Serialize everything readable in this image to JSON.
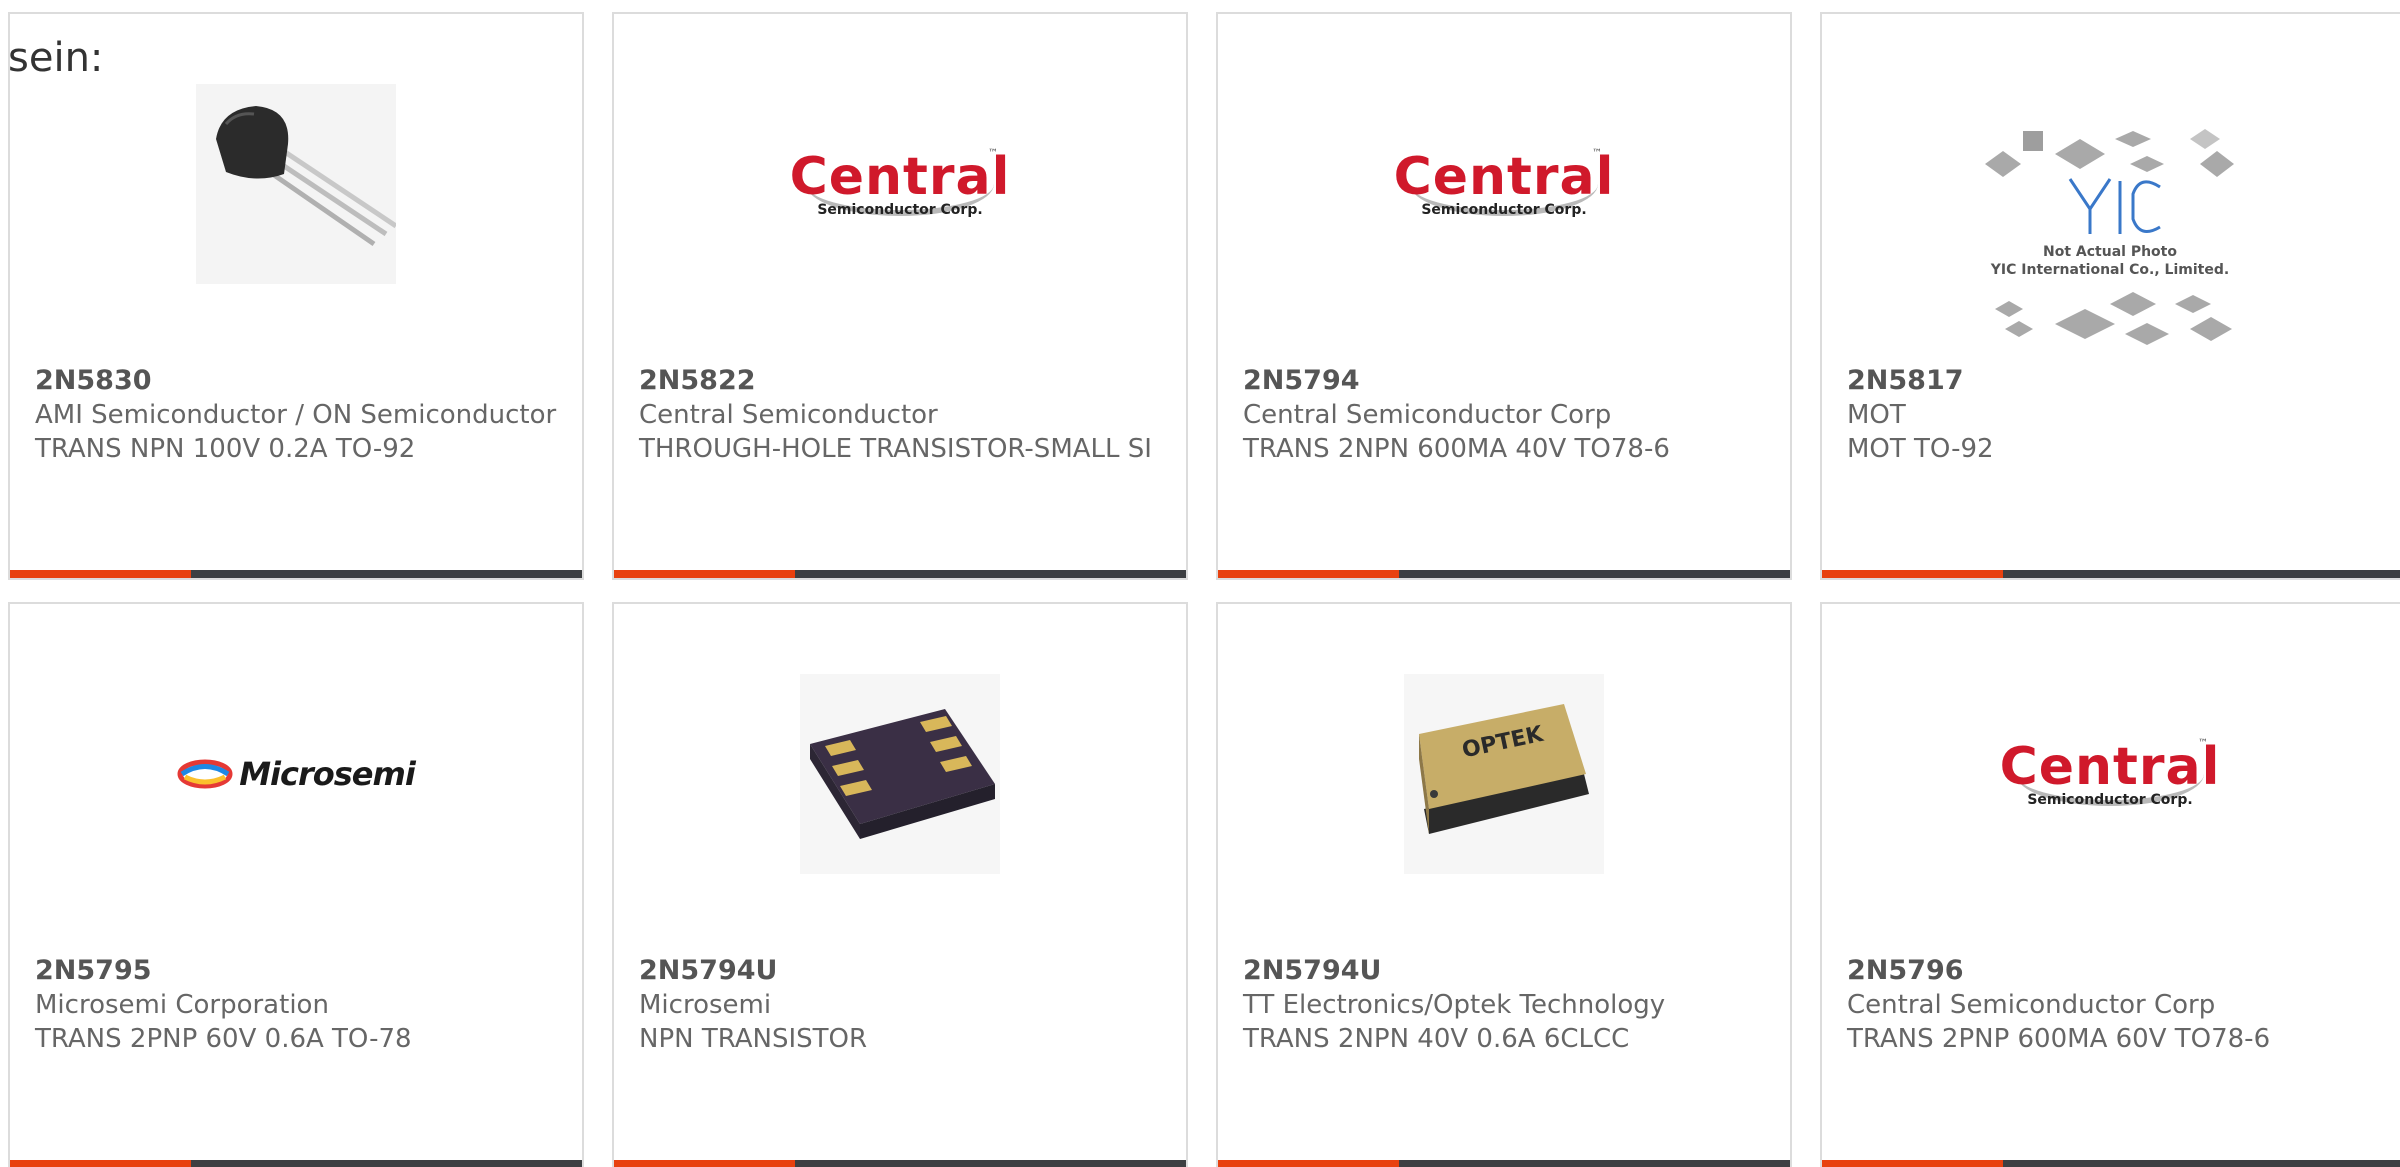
{
  "lead_text": "sein:",
  "cards": [
    {
      "part_number": "2N5830",
      "manufacturer": "AMI Semiconductor / ON Semiconductor",
      "description": "TRANS NPN 100V 0.2A TO-92",
      "image": "transistor-to92-photo"
    },
    {
      "part_number": "2N5822",
      "manufacturer": "Central Semiconductor",
      "description": "THROUGH-HOLE TRANSISTOR-SMALL SI",
      "image": "central-logo"
    },
    {
      "part_number": "2N5794",
      "manufacturer": "Central Semiconductor Corp",
      "description": "TRANS 2NPN 600MA 40V TO78-6",
      "image": "central-logo"
    },
    {
      "part_number": "2N5817",
      "manufacturer": "MOT",
      "description": "MOT TO-92",
      "image": "yic-placeholder"
    },
    {
      "part_number": "2N5795",
      "manufacturer": "Microsemi Corporation",
      "description": "TRANS 2PNP 60V 0.6A TO-78",
      "image": "microsemi-logo"
    },
    {
      "part_number": "2N5794U",
      "manufacturer": "Microsemi",
      "description": "NPN TRANSISTOR",
      "image": "smd-6-pad-package-photo"
    },
    {
      "part_number": "2N5794U",
      "manufacturer": "TT Electronics/Optek Technology",
      "description": "TRANS 2NPN 40V 0.6A 6CLCC",
      "image": "optek-clcc-package-photo"
    },
    {
      "part_number": "2N5796",
      "manufacturer": "Central Semiconductor Corp",
      "description": "TRANS 2PNP 600MA 60V TO78-6",
      "image": "central-logo"
    }
  ],
  "logos": {
    "central_word": "Central",
    "central_sub": "Semiconductor Corp.",
    "central_tm": "™",
    "microsemi_word": "Microsemi",
    "optek_word": "OPTEK",
    "yic_caption_line1": "Not Actual Photo",
    "yic_caption_line2": "YIC International Co., Limited."
  },
  "colors": {
    "accent": "#e8410f",
    "bar": "#3d3f42",
    "central_red": "#d0192b"
  }
}
